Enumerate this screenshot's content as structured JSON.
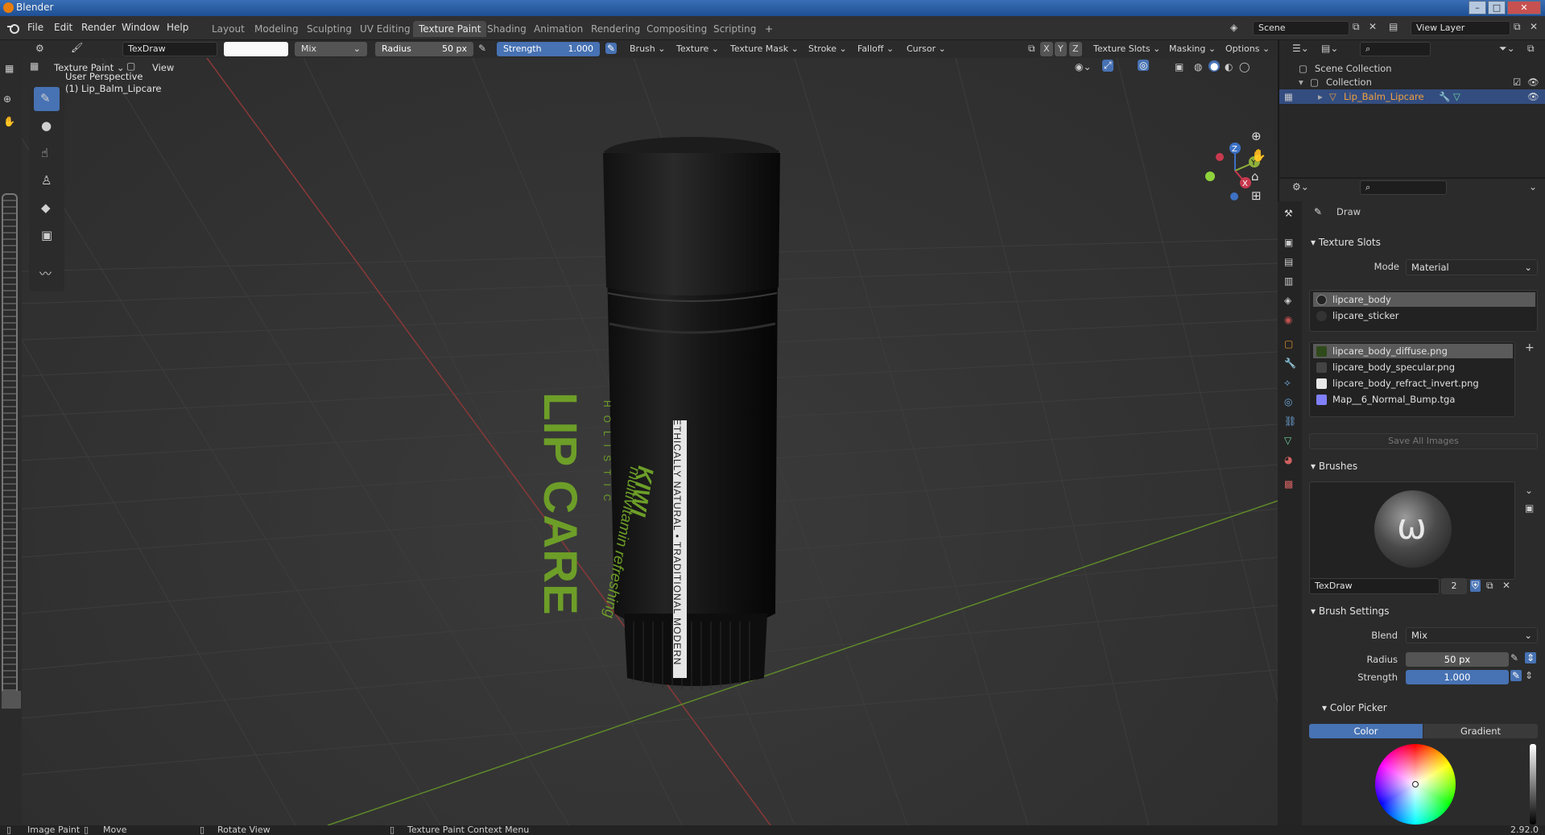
{
  "window": {
    "title": "Blender"
  },
  "menu": [
    "File",
    "Edit",
    "Render",
    "Window",
    "Help"
  ],
  "workspaces": [
    "Layout",
    "Modeling",
    "Sculpting",
    "UV Editing",
    "Texture Paint",
    "Shading",
    "Animation",
    "Rendering",
    "Compositing",
    "Scripting"
  ],
  "active_workspace": "Texture Paint",
  "add_workspace": "+",
  "scene": {
    "label": "Scene",
    "view_layer": "View Layer"
  },
  "toolheader": {
    "brush_name": "TexDraw",
    "blend": "Mix",
    "radius_label": "Radius",
    "radius_value": "50 px",
    "strength_label": "Strength",
    "strength_value": "1.000",
    "menus": [
      "Brush",
      "Texture",
      "Texture Mask",
      "Stroke",
      "Falloff",
      "Cursor"
    ],
    "axis": [
      "X",
      "Y",
      "Z"
    ],
    "right_menus": [
      "Texture Slots",
      "Masking",
      "Options"
    ]
  },
  "viewheader": {
    "mode": "Texture Paint",
    "view": "View"
  },
  "viewport": {
    "perspective": "User Perspective",
    "object": "(1) Lip_Balm_Lipcare",
    "label": {
      "brand_small": "HOLISTIC",
      "brand": "LIP CARE",
      "tagline": "ETHICALLY NATURAL • TRADITIONAL MODERN",
      "flavor": "KIWI",
      "desc": "multivitamin refreshing"
    },
    "gizmo": {
      "x": "X",
      "y": "Y",
      "z": "Z"
    }
  },
  "outliner": {
    "scene_collection": "Scene Collection",
    "collection": "Collection",
    "object": "Lip_Balm_Lipcare"
  },
  "properties": {
    "tool": "Draw",
    "texture_slots": {
      "title": "Texture Slots",
      "mode_label": "Mode",
      "mode_value": "Material",
      "materials": [
        "lipcare_body",
        "lipcare_sticker"
      ],
      "images": [
        {
          "name": "lipcare_body_diffuse.png",
          "color": "#2f4a1a"
        },
        {
          "name": "lipcare_body_specular.png",
          "color": "#444444"
        },
        {
          "name": "lipcare_body_refract_invert.png",
          "color": "#e8e8e8"
        },
        {
          "name": "Map__6_Normal_Bump.tga",
          "color": "#8080ff"
        }
      ],
      "save_all": "Save All Images"
    },
    "brushes": {
      "title": "Brushes",
      "name": "TexDraw",
      "users": "2"
    },
    "brush_settings": {
      "title": "Brush Settings",
      "blend_label": "Blend",
      "blend_value": "Mix",
      "radius_label": "Radius",
      "radius_value": "50 px",
      "strength_label": "Strength",
      "strength_value": "1.000"
    },
    "color_picker": {
      "title": "Color Picker",
      "tab_color": "Color",
      "tab_gradient": "Gradient"
    }
  },
  "status": {
    "items": [
      "Image Paint",
      "Move",
      "Rotate View",
      "Texture Paint Context Menu"
    ],
    "version": "2.92.0"
  }
}
